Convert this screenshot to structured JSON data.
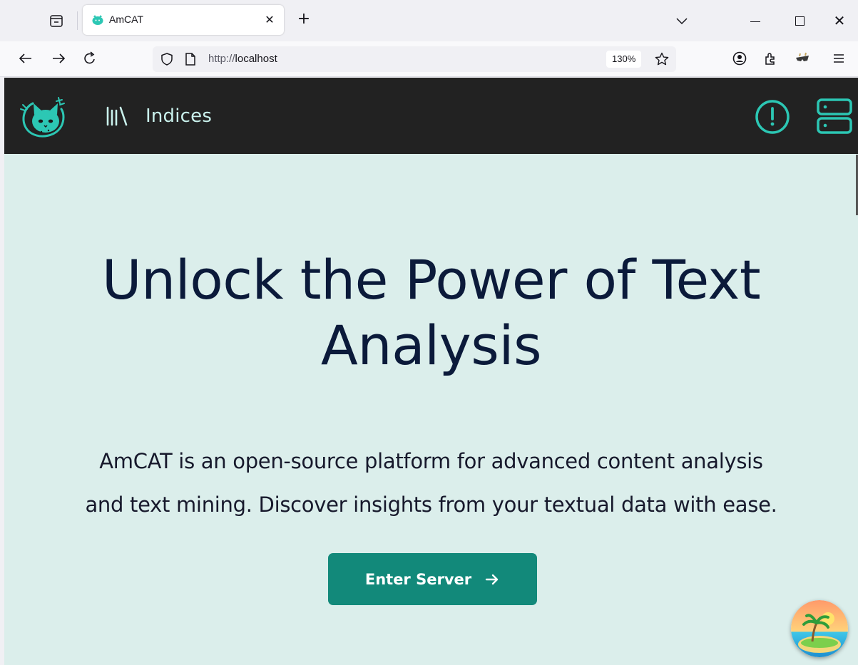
{
  "browser": {
    "tab": {
      "title": "AmCAT",
      "close_glyph": "✕",
      "favicon": "amcat-cat-icon"
    },
    "new_tab_glyph": "+",
    "window_controls": {
      "close_glyph": "✕"
    },
    "url": {
      "scheme": "http://",
      "host": "localhost"
    },
    "zoom": "130%",
    "icons": [
      "tab-list-icon",
      "back-arrow-icon",
      "forward-arrow-icon",
      "reload-icon",
      "shield-icon",
      "page-icon",
      "star-icon",
      "account-icon",
      "extensions-icon",
      "extension-shades-icon",
      "menu-icon"
    ]
  },
  "app": {
    "nav": {
      "indices_label": "Indices"
    },
    "hero": {
      "title_line1": "Unlock the Power of Text",
      "title_line2": "Analysis",
      "description_line1": "AmCAT is an open-source platform for advanced content analysis",
      "description_line2": "and text mining. Discover insights from your textual data with ease."
    },
    "cta": {
      "label": "Enter Server"
    }
  },
  "colors": {
    "appbar_bg": "#222222",
    "accent_teal": "#2cc7b4",
    "page_bg": "#dbeeeb",
    "button_bg": "#12897a",
    "title_color": "#0b1a3a"
  }
}
